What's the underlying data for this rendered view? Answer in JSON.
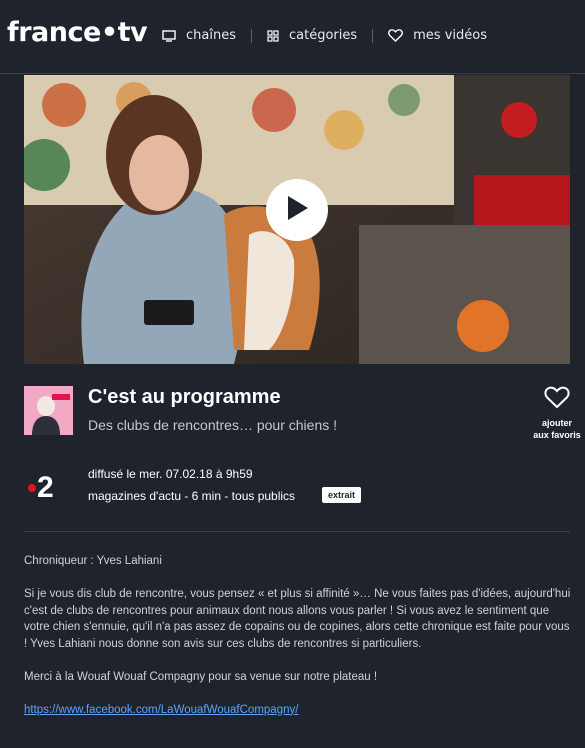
{
  "header": {
    "logo": "france•tv",
    "nav": [
      {
        "label": "chaînes",
        "icon": "tv-icon"
      },
      {
        "label": "catégories",
        "icon": "grid-icon"
      },
      {
        "label": "mes vidéos",
        "icon": "heart-icon"
      }
    ]
  },
  "video": {
    "play_icon": "play-icon"
  },
  "program": {
    "thumbnail_text": "C'EST AU PROGRAMME",
    "title": "C'est au programme",
    "subtitle": "Des clubs de rencontres… pour chiens !",
    "favorite_label_1": "ajouter",
    "favorite_label_2": "aux favoris"
  },
  "broadcast": {
    "channel": "2",
    "aired": "diffusé le mer. 07.02.18 à 9h59",
    "details": "magazines d'actu - 6 min - tous publics",
    "badge": "extrait"
  },
  "description": {
    "host": "Chroniqueur : Yves Lahiani",
    "body": "Si je vous dis club de rencontre, vous pensez « et plus si affinité »… Ne vous faites pas d'idées, aujourd'hui c'est de clubs de rencontres pour animaux dont nous allons vous parler ! Si vous avez le sentiment que votre chien s'ennuie, qu'il n'a pas assez de copains ou de copines, alors cette chronique est faite pour vous ! Yves Lahiani nous donne son avis sur ces clubs de rencontres si particuliers.",
    "thanks": "Merci à la Wouaf Wouaf Compagny pour sa venue sur notre plateau !",
    "link": "https://www.facebook.com/LaWouafWouafCompagny/"
  },
  "colors": {
    "background": "#1f232c",
    "channel_dot": "#e2131c",
    "link": "#5ea3ff"
  }
}
